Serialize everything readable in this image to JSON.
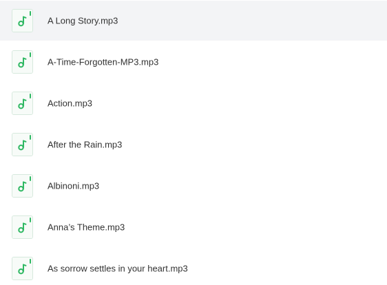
{
  "accent_color": "#2fb863",
  "selected_index": 0,
  "files": [
    {
      "name": "A Long Story.mp3",
      "icon": "music-file-icon"
    },
    {
      "name": "A-Time-Forgotten-MP3.mp3",
      "icon": "music-file-icon"
    },
    {
      "name": "Action.mp3",
      "icon": "music-file-icon"
    },
    {
      "name": "After the Rain.mp3",
      "icon": "music-file-icon"
    },
    {
      "name": "Albinoni.mp3",
      "icon": "music-file-icon"
    },
    {
      "name": "Anna’s Theme.mp3",
      "icon": "music-file-icon"
    },
    {
      "name": "As sorrow settles in your heart.mp3",
      "icon": "music-file-icon"
    }
  ]
}
